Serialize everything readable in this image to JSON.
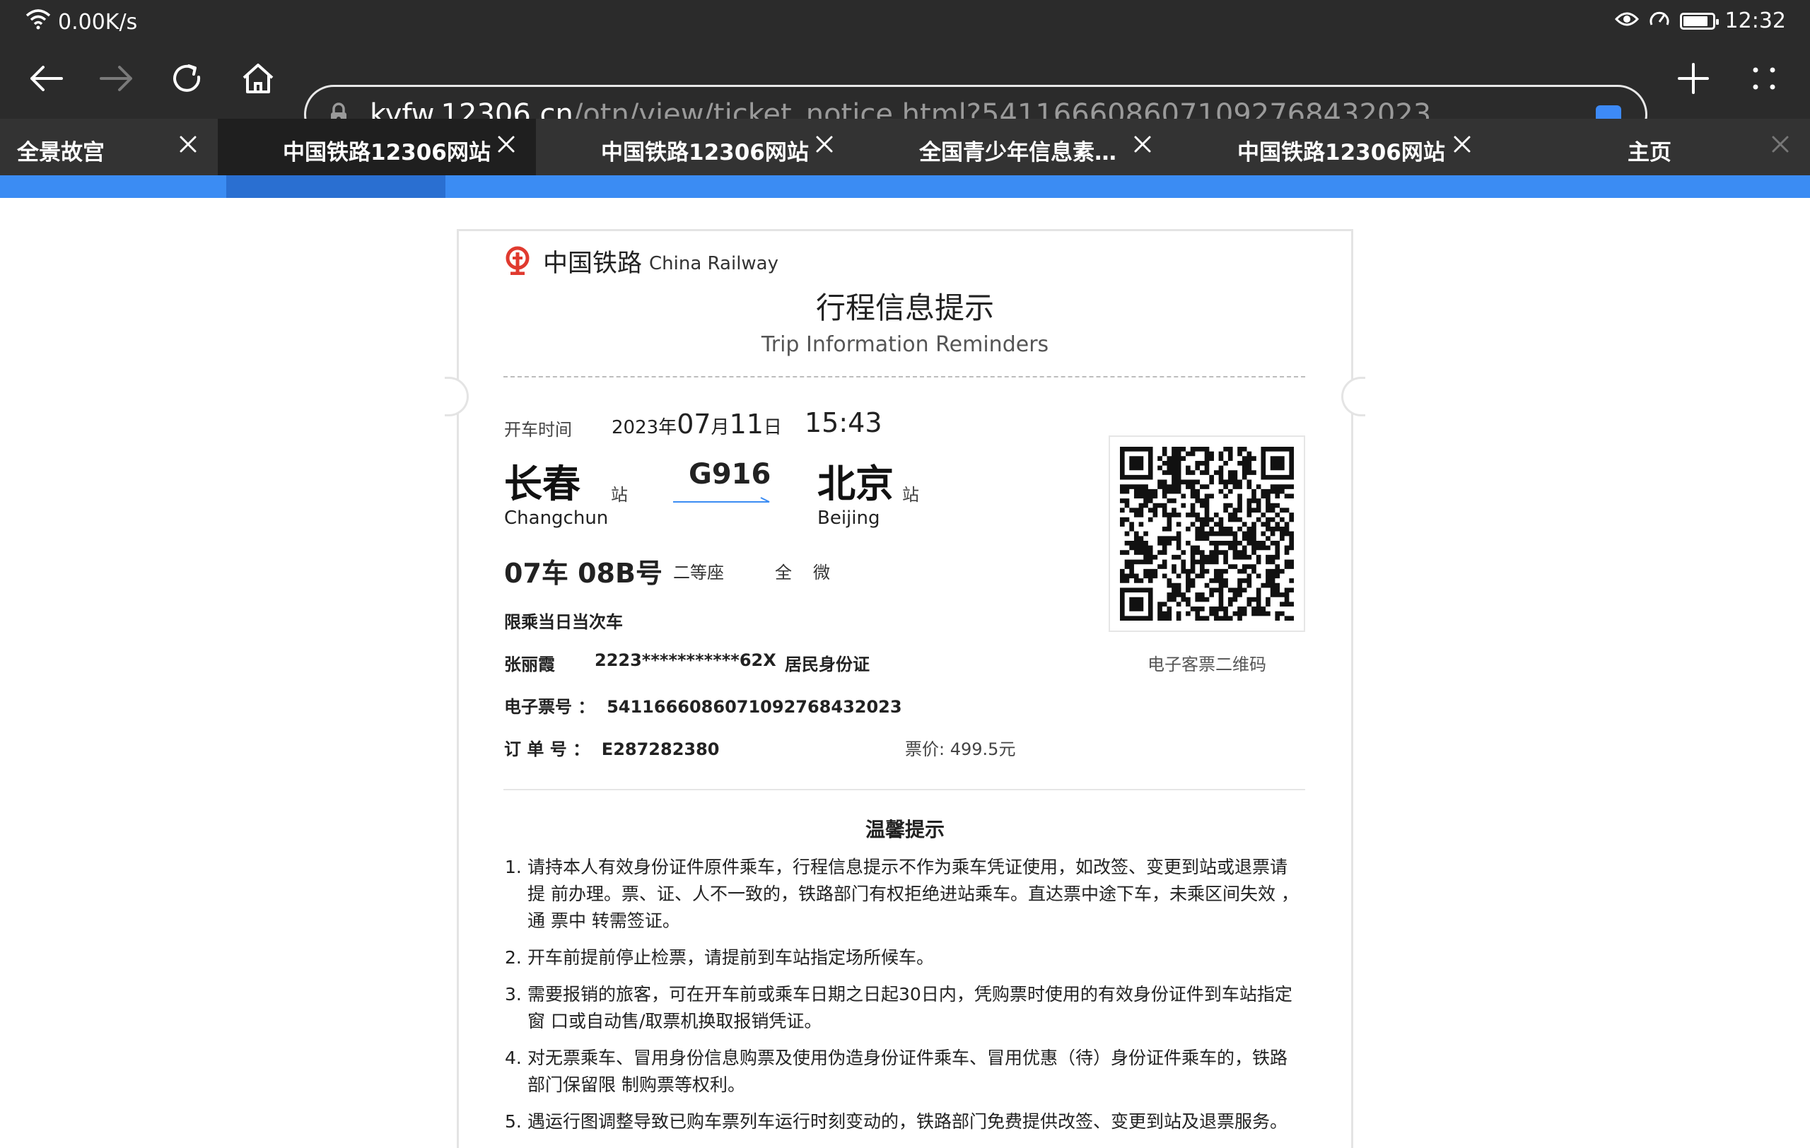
{
  "status_bar": {
    "network_speed": "0.00K/s",
    "time": "12:32",
    "battery_level": 0.85
  },
  "url_bar": {
    "domain": "kyfw.12306.cn",
    "path": "/otn/view/ticket_notice.html?541166608607109276843202​3"
  },
  "tabs": [
    {
      "label": "全景故宫",
      "active": false
    },
    {
      "label": "中国铁路12306网站",
      "active": true
    },
    {
      "label": "中国铁路12306网站",
      "active": false
    },
    {
      "label": "全国青少年信息素…",
      "active": false
    },
    {
      "label": "中国铁路12306网站",
      "active": false
    },
    {
      "label": "主页",
      "active": false
    }
  ],
  "colors": {
    "browser_chrome": "#2b2b2b",
    "page_strip": "#3b8cf3",
    "railway_logo": "#e03a2f",
    "train_arrow": "#3b8cf3"
  },
  "ticket": {
    "brand_cn": "中国铁路",
    "brand_en": "China Railway",
    "title_cn": "行程信息提示",
    "title_en": "Trip Information Reminders",
    "depart_label": "开车时间",
    "date": {
      "year": "2023",
      "year_unit": "年",
      "month": "07",
      "month_unit": "月",
      "day": "11",
      "day_unit": "日"
    },
    "time": "15:43",
    "from_station": "长春",
    "from_station_en": "Changchun",
    "to_station": "北京",
    "to_station_en": "Beijing",
    "station_suffix": "站",
    "train_no": "G916",
    "seat": "07车 08B号",
    "seat_class": "二等座",
    "fare_type": "全",
    "channel": "微",
    "restriction": "限乘当日当次车",
    "passenger_name": "张丽霞",
    "passenger_id": "2223***********62X",
    "id_type": "居民身份证",
    "eticket_label": "电子票号 ：",
    "eticket_no": "541166608607109276843202​3",
    "order_label": "订 单 号 ：",
    "order_no": "E287282380",
    "price_label": "票价:",
    "price_value": "499.5元",
    "qr_caption": "电子客票二维码"
  },
  "tips": {
    "title": "温馨提示",
    "items": [
      {
        "num": "1.",
        "text": "请持本人有效身份证件原件乘车，行程信息提示不作为乘车凭证使用，如改签、变更到站或退票请 提 前办理。票、证、人不一致的，铁路部门有权拒绝进站乘车。直达票中途下车，未乘区间失效 ， 通 票中 转需签证。"
      },
      {
        "num": "2.",
        "text": "开车前提前停止检票，请提前到车站指定场所候车。"
      },
      {
        "num": "3.",
        "text": "需要报销的旅客，可在开车前或乘车日期之日起30日内，凭购票时使用的有效身份证件到车站指定窗 口或自动售/取票机换取报销凭证。"
      },
      {
        "num": "4.",
        "text": "对无票乘车、冒用身份信息购票及使用伪造身份证件乘车、冒用优惠（待）身份证件乘车的，铁路 部门保留限 制购票等权利。"
      },
      {
        "num": "5.",
        "text": "遇运行图调整导致已购车票列车运行时刻变动的，铁路部门免费提供改签、变更到站及退票服务。"
      }
    ]
  }
}
